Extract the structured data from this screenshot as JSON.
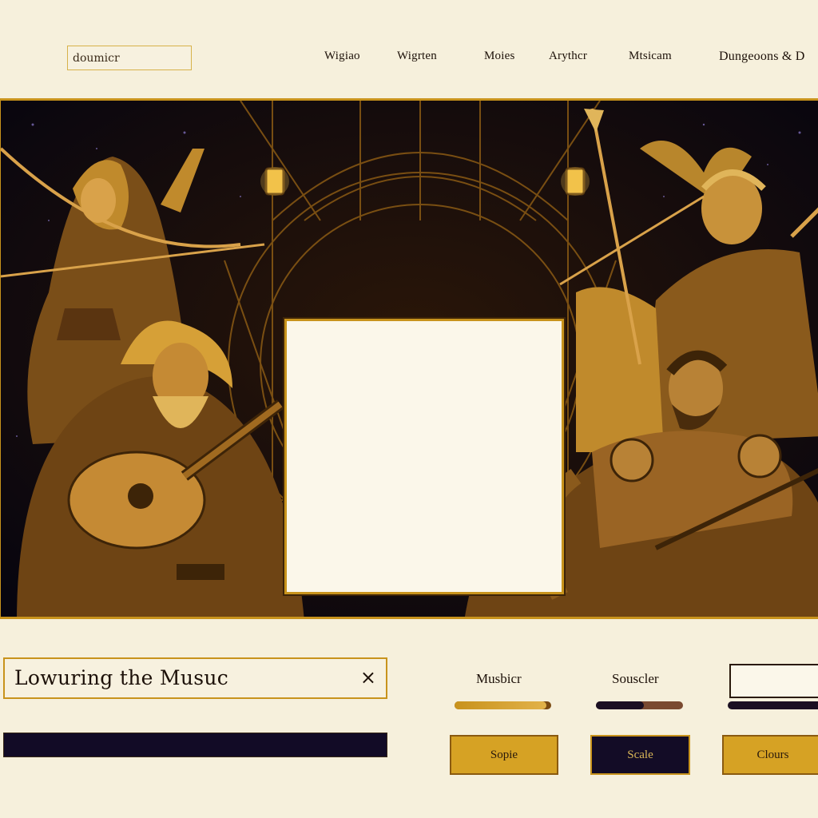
{
  "search": {
    "value": "doumicr"
  },
  "nav": {
    "items": [
      {
        "label": "Wigiao"
      },
      {
        "label": "Wigrten"
      },
      {
        "label": "Moies"
      },
      {
        "label": "Arythcr"
      },
      {
        "label": "Mtsicam"
      },
      {
        "label": "Dungeoons & D"
      }
    ]
  },
  "hero": {
    "description_icons": [
      "bard-character",
      "archer-character",
      "elf-character",
      "warrior-character",
      "lantern-icon"
    ]
  },
  "player": {
    "track_title": "Lowuring the Musuc",
    "close_symbol": "×",
    "progress": 1.0
  },
  "controls": {
    "music_label": "Musbicr",
    "sound_label": "Souscler",
    "music_level": 0.95,
    "sound_level": 0.55
  },
  "buttons": {
    "save": "Sopie",
    "scale": "Scale",
    "close": "Clours"
  },
  "colors": {
    "gold": "#c8931c",
    "dark": "#130c26",
    "cream": "#f6f0dc"
  }
}
